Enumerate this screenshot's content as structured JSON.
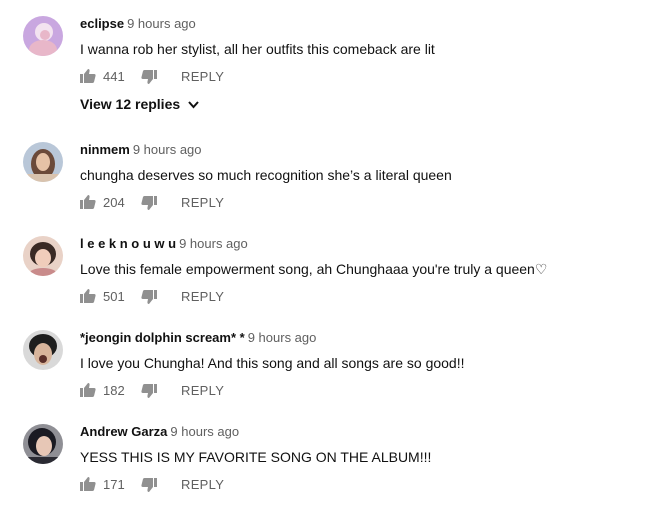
{
  "comments": [
    {
      "author": "eclipse",
      "time": "9 hours ago",
      "text": "I wanna rob her stylist, all her outfits this comeback are lit",
      "likes": "441",
      "reply_label": "REPLY",
      "avatar": {
        "bg": "#c9a7e0",
        "hair": "#f3e3f0",
        "skin": "#e8b7c9"
      },
      "view_replies": "View 12 replies"
    },
    {
      "author": "ninmem",
      "time": "9 hours ago",
      "text": "chungha deserves so much recognition she’s a literal queen",
      "likes": "204",
      "reply_label": "REPLY",
      "avatar": {
        "bg": "#b9c7d8",
        "hair": "#6b4a3a",
        "skin": "#e6c2a6"
      }
    },
    {
      "author": "l e e k n o u w u",
      "time": "9 hours ago",
      "text": "Love this female empowerment song, ah Chunghaaa you're truly a queen♡",
      "likes": "501",
      "reply_label": "REPLY",
      "avatar": {
        "bg": "#e9d2c7",
        "hair": "#3a2a25",
        "skin": "#f0cdbb"
      }
    },
    {
      "author": "*jeongin dolphin scream* *",
      "time": "9 hours ago",
      "text": "I love you Chungha! And this song and all songs are so good!!",
      "likes": "182",
      "reply_label": "REPLY",
      "avatar": {
        "bg": "#d9d9d9",
        "hair": "#1e1e1e",
        "skin": "#d8b59c"
      }
    },
    {
      "author": "Andrew Garza",
      "time": "9 hours ago",
      "text": "YESS THIS IS MY FAVORITE SONG ON THE ALBUM!!!",
      "likes": "171",
      "reply_label": "REPLY",
      "avatar": {
        "bg": "#8f8f95",
        "hair": "#1a1a22",
        "skin": "#e7c7b6"
      }
    }
  ],
  "icons": {
    "like": "thumbs-up-icon",
    "dislike": "thumbs-down-icon",
    "expand": "chevron-down-icon"
  },
  "colors": {
    "meta": "#606060",
    "text": "#111111",
    "icon": "#909090"
  }
}
